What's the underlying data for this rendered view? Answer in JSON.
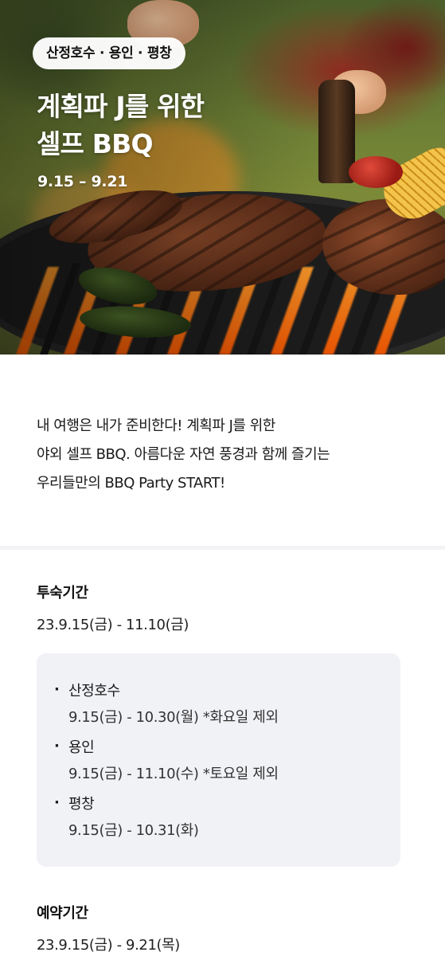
{
  "hero": {
    "chip": "산정호수 · 용인 · 평창",
    "title_line1": "계획파 J를 위한",
    "title_line2": "셀프 BBQ",
    "date": "9.15 – 9.21",
    "image_icon": "bbq-grill-photo"
  },
  "intro": {
    "line1": "내 여행은 내가 준비한다! 계획파 J를 위한",
    "line2": "야외 셀프 BBQ. 아름다운 자연 풍경과 함께 즐기는",
    "line3": "우리들만의 BBQ Party START!"
  },
  "stay": {
    "heading": "투숙기간",
    "value": "23.9.15(금) - 11.10(금)",
    "locations": [
      {
        "bullet": "·",
        "name": "산정호수",
        "dates": "9.15(금) - 10.30(월) *화요일 제외"
      },
      {
        "bullet": "·",
        "name": "용인",
        "dates": "9.15(금) - 11.10(수) *토요일 제외"
      },
      {
        "bullet": "·",
        "name": "평창",
        "dates": "9.15(금) - 10.31(화)"
      }
    ]
  },
  "booking": {
    "heading": "예약기간",
    "value": "23.9.15(금) - 9.21(목)"
  },
  "colors": {
    "box_bg": "#f1f2f6",
    "divider": "#f2f3f5",
    "text": "#222222"
  }
}
